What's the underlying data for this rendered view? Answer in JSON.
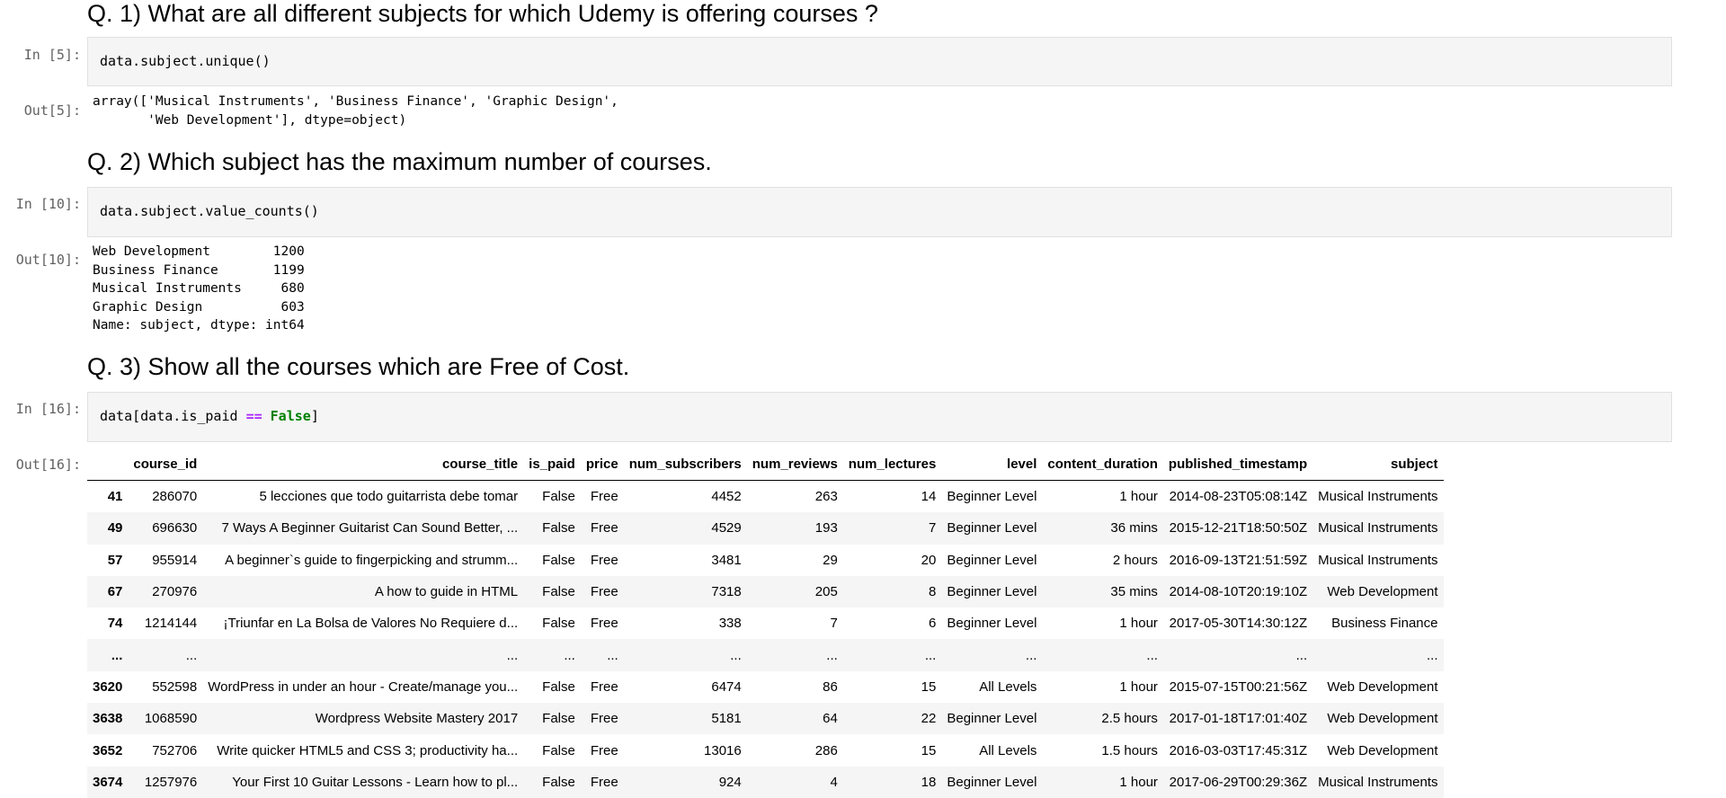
{
  "q1": {
    "heading": "Q. 1) What are all different subjects for which Udemy is offering courses ?",
    "in_prompt": "In [5]:",
    "out_prompt": "Out[5]:",
    "code": "data.subject.unique()",
    "output": "array(['Musical Instruments', 'Business Finance', 'Graphic Design',\n       'Web Development'], dtype=object)"
  },
  "q2": {
    "heading": "Q. 2) Which subject has the maximum number of courses.",
    "in_prompt": "In [10]:",
    "out_prompt": "Out[10]:",
    "code": "data.subject.value_counts()",
    "output": "Web Development        1200\nBusiness Finance       1199\nMusical Instruments     680\nGraphic Design          603\nName: subject, dtype: int64"
  },
  "q3": {
    "heading": "Q. 3) Show all the courses which are Free of Cost.",
    "in_prompt": "In [16]:",
    "out_prompt": "Out[16]:",
    "code_parts": {
      "a": "data[data.is_paid ",
      "op": "==",
      "sp": " ",
      "kw": "False",
      "end": "]"
    },
    "table": {
      "columns": [
        "",
        "course_id",
        "course_title",
        "is_paid",
        "price",
        "num_subscribers",
        "num_reviews",
        "num_lectures",
        "level",
        "content_duration",
        "published_timestamp",
        "subject"
      ],
      "rows": [
        [
          "41",
          "286070",
          "5 lecciones que todo guitarrista debe tomar",
          "False",
          "Free",
          "4452",
          "263",
          "14",
          "Beginner Level",
          "1 hour",
          "2014-08-23T05:08:14Z",
          "Musical Instruments"
        ],
        [
          "49",
          "696630",
          "7 Ways A Beginner Guitarist Can Sound Better, ...",
          "False",
          "Free",
          "4529",
          "193",
          "7",
          "Beginner Level",
          "36 mins",
          "2015-12-21T18:50:50Z",
          "Musical Instruments"
        ],
        [
          "57",
          "955914",
          "A beginner`s guide to fingerpicking and strumm...",
          "False",
          "Free",
          "3481",
          "29",
          "20",
          "Beginner Level",
          "2 hours",
          "2016-09-13T21:51:59Z",
          "Musical Instruments"
        ],
        [
          "67",
          "270976",
          "A how to guide in HTML",
          "False",
          "Free",
          "7318",
          "205",
          "8",
          "Beginner Level",
          "35 mins",
          "2014-08-10T20:19:10Z",
          "Web Development"
        ],
        [
          "74",
          "1214144",
          "¡Triunfar en La Bolsa de Valores No Requiere d...",
          "False",
          "Free",
          "338",
          "7",
          "6",
          "Beginner Level",
          "1 hour",
          "2017-05-30T14:30:12Z",
          "Business Finance"
        ],
        [
          "...",
          "...",
          "...",
          "...",
          "...",
          "...",
          "...",
          "...",
          "...",
          "...",
          "...",
          "..."
        ],
        [
          "3620",
          "552598",
          "WordPress in under an hour - Create/manage you...",
          "False",
          "Free",
          "6474",
          "86",
          "15",
          "All Levels",
          "1 hour",
          "2015-07-15T00:21:56Z",
          "Web Development"
        ],
        [
          "3638",
          "1068590",
          "Wordpress Website Mastery 2017",
          "False",
          "Free",
          "5181",
          "64",
          "22",
          "Beginner Level",
          "2.5 hours",
          "2017-01-18T17:01:40Z",
          "Web Development"
        ],
        [
          "3652",
          "752706",
          "Write quicker HTML5 and CSS 3; productivity ha...",
          "False",
          "Free",
          "13016",
          "286",
          "15",
          "All Levels",
          "1.5 hours",
          "2016-03-03T17:45:31Z",
          "Web Development"
        ],
        [
          "3674",
          "1257976",
          "Your First 10 Guitar Lessons - Learn how to pl...",
          "False",
          "Free",
          "924",
          "4",
          "18",
          "Beginner Level",
          "1 hour",
          "2017-06-29T00:29:36Z",
          "Musical Instruments"
        ]
      ]
    }
  }
}
